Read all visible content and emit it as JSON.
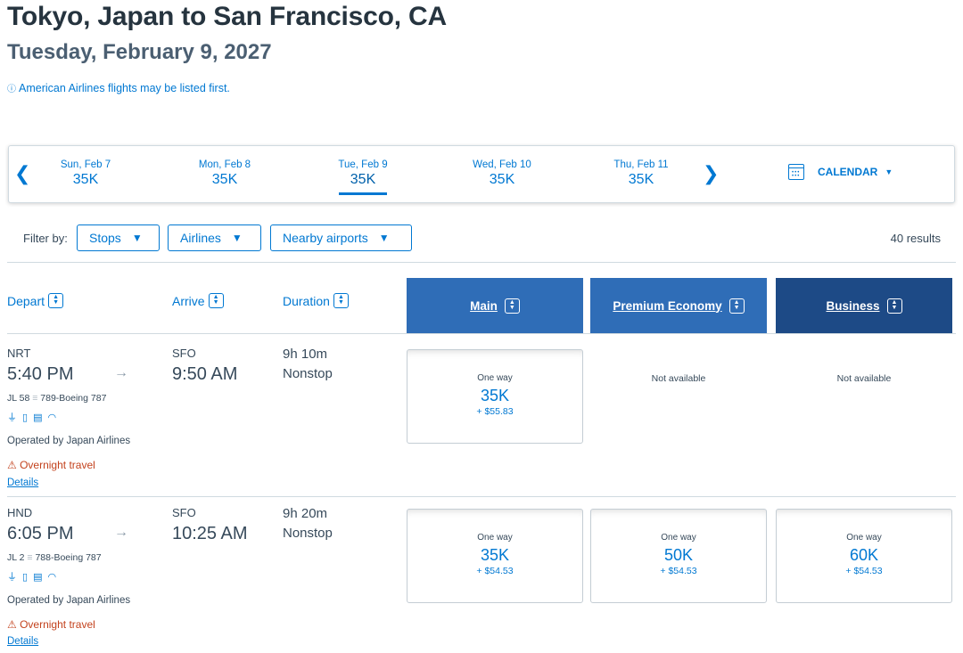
{
  "header": {
    "title": "Tokyo, Japan to San Francisco, CA",
    "date": "Tuesday, February 9, 2027",
    "note_icon": "ⓘ",
    "note": "American Airlines flights may be listed first."
  },
  "datebar": {
    "prev": "❮",
    "next": "❯",
    "days": [
      {
        "label": "Sun, Feb 7",
        "price": "35K"
      },
      {
        "label": "Mon, Feb 8",
        "price": "35K"
      },
      {
        "label": "Tue, Feb 9",
        "price": "35K",
        "selected": true
      },
      {
        "label": "Wed, Feb 10",
        "price": "35K"
      },
      {
        "label": "Thu, Feb 11",
        "price": "35K"
      }
    ],
    "calendar_label": "CALENDAR"
  },
  "filters": {
    "label": "Filter by:",
    "buttons": [
      "Stops",
      "Airlines",
      "Nearby airports"
    ],
    "results": "40 results"
  },
  "columns": {
    "depart": "Depart",
    "arrive": "Arrive",
    "duration": "Duration",
    "main": "Main",
    "premium": "Premium Economy",
    "business": "Business"
  },
  "flights": [
    {
      "from": "NRT",
      "depart_time": "5:40 PM",
      "to": "SFO",
      "arrive_time": "9:50 AM",
      "duration": "9h 10m",
      "stops": "Nonstop",
      "flight_no": "JL 58",
      "aircraft": "789-Boeing 787",
      "operated": "Operated by Japan Airlines",
      "overnight": "⚠ Overnight travel",
      "details": "Details",
      "fares": [
        {
          "type": "One way",
          "points": "35K",
          "tax": "+ $55.83"
        },
        {
          "na": "Not available"
        },
        {
          "na": "Not available"
        }
      ]
    },
    {
      "from": "HND",
      "depart_time": "6:05 PM",
      "to": "SFO",
      "arrive_time": "10:25 AM",
      "duration": "9h 20m",
      "stops": "Nonstop",
      "flight_no": "JL 2",
      "aircraft": "788-Boeing 787",
      "operated": "Operated by Japan Airlines",
      "overnight": "⚠ Overnight travel",
      "details": "Details",
      "fares": [
        {
          "type": "One way",
          "points": "35K",
          "tax": "+ $54.53"
        },
        {
          "type": "One way",
          "points": "50K",
          "tax": "+ $54.53"
        },
        {
          "type": "One way",
          "points": "60K",
          "tax": "+ $54.53"
        }
      ]
    }
  ],
  "colors": {
    "accent": "#0078d2",
    "cabin_main": "#2f6db7",
    "cabin_business": "#1d4a86",
    "warning": "#c3421d"
  }
}
